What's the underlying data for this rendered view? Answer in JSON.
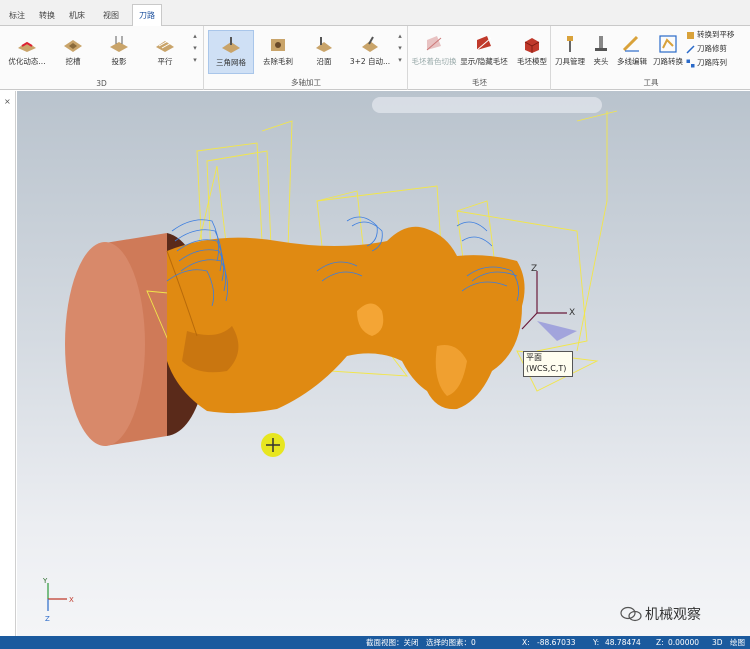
{
  "tabs": [
    {
      "label": "标注",
      "active": false
    },
    {
      "label": "转换",
      "active": false
    },
    {
      "label": "机床",
      "active": false
    },
    {
      "label": "视图",
      "active": false
    },
    {
      "label": "刀路",
      "active": true
    }
  ],
  "ribbon": {
    "group_3d": {
      "label": "3D",
      "buttons": [
        "优化动态...",
        "挖槽",
        "投影",
        "平行"
      ]
    },
    "group_multiaxis": {
      "label": "多轴加工",
      "buttons": [
        "三角网格",
        "去除毛刺",
        "沿面",
        "3+2 自动..."
      ]
    },
    "group_stock": {
      "label": "毛坯",
      "buttons": [
        "毛坯着色切换",
        "显示/隐藏毛坯",
        "毛坯模型"
      ]
    },
    "group_tools": {
      "label": "工具",
      "buttons": [
        "刀具管理",
        "夹头",
        "多线编辑",
        "刀路转换"
      ],
      "small_items": [
        "转换到平移",
        "刀路修剪",
        "刀路阵列"
      ]
    }
  },
  "viewport": {
    "plane_tooltip_line1": "平面",
    "plane_tooltip_line2": "(WCS,C,T)",
    "axis_x": "X",
    "axis_y": "Y",
    "axis_z": "Z"
  },
  "statusbar": {
    "section_view": "截面视图：关闭",
    "selected": "选择的图素：0",
    "x_label": "X:",
    "x_value": "-88.67033",
    "y_label": "Y:",
    "y_value": "48.78474",
    "z_label": "Z:",
    "z_value": "0.00000",
    "mode": "3D",
    "extra": "绘图"
  },
  "watermark": "机械观察",
  "colors": {
    "part_orange": "#e08a12",
    "stock_copper": "#d07a5a",
    "toolpath_blue": "#3a7de0",
    "toolpath_yellow": "#f4e84a",
    "statusbar": "#1b5a9e"
  }
}
